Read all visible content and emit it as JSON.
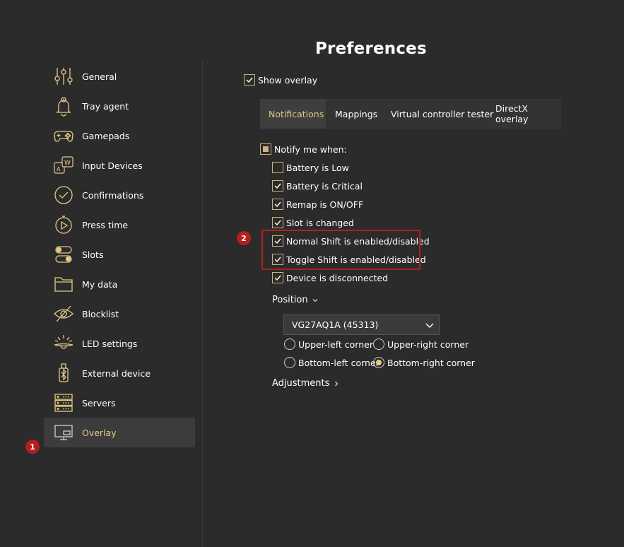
{
  "page": {
    "title": "Preferences"
  },
  "sidebar": {
    "items": [
      {
        "label": "General",
        "icon": "sliders-icon"
      },
      {
        "label": "Tray agent",
        "icon": "bell-icon"
      },
      {
        "label": "Gamepads",
        "icon": "gamepad-icon"
      },
      {
        "label": "Input Devices",
        "icon": "keys-icon"
      },
      {
        "label": "Confirmations",
        "icon": "check-circle-icon"
      },
      {
        "label": "Press time",
        "icon": "timer-icon"
      },
      {
        "label": "Slots",
        "icon": "toggles-icon"
      },
      {
        "label": "My data",
        "icon": "folder-icon"
      },
      {
        "label": "Blocklist",
        "icon": "eye-off-icon"
      },
      {
        "label": "LED settings",
        "icon": "lamp-icon"
      },
      {
        "label": "External device",
        "icon": "bluetooth-usb-icon"
      },
      {
        "label": "Servers",
        "icon": "server-icon"
      },
      {
        "label": "Overlay",
        "icon": "monitor-icon",
        "active": true
      }
    ]
  },
  "annotations": {
    "badge1": "1",
    "badge2": "2"
  },
  "overlay": {
    "show_overlay": {
      "label": "Show overlay",
      "checked": true
    },
    "tabs": [
      {
        "label": "Notifications",
        "active": true
      },
      {
        "label": "Mappings"
      },
      {
        "label": "Virtual controller tester"
      },
      {
        "label": "DirectX overlay"
      }
    ],
    "notify": {
      "label": "Notify me when:",
      "state": "indeterminate",
      "options": [
        {
          "label": "Battery is Low",
          "checked": false
        },
        {
          "label": "Battery is Critical",
          "checked": true
        },
        {
          "label": "Remap is ON/OFF",
          "checked": true
        },
        {
          "label": "Slot is changed",
          "checked": true
        },
        {
          "label": "Normal Shift is enabled/disabled",
          "checked": true
        },
        {
          "label": "Toggle Shift is enabled/disabled",
          "checked": true
        },
        {
          "label": "Device is disconnected",
          "checked": true
        }
      ]
    },
    "position": {
      "label": "Position",
      "monitor_select": "VG27AQ1A (45313)",
      "corners": [
        {
          "label": "Upper-left corner",
          "selected": false
        },
        {
          "label": "Upper-right corner",
          "selected": false
        },
        {
          "label": "Bottom-left corner",
          "selected": false
        },
        {
          "label": "Bottom-right corner",
          "selected": true
        }
      ]
    },
    "adjustments": {
      "label": "Adjustments"
    }
  },
  "colors": {
    "accent": "#e5c988",
    "badge": "#b3201b",
    "background": "#2b2b2b"
  }
}
